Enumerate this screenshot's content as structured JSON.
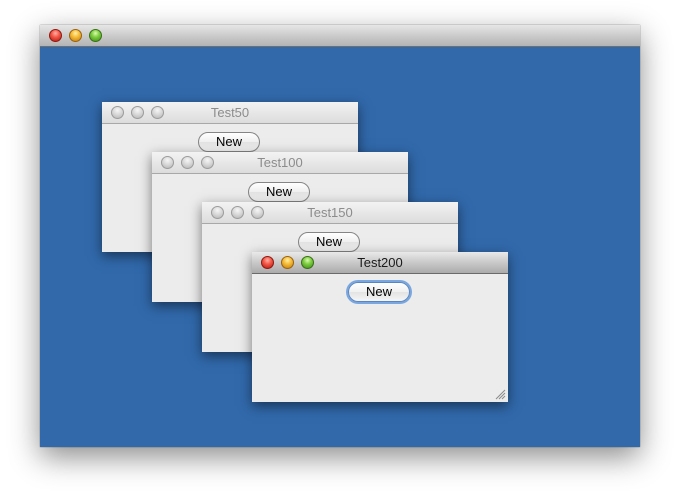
{
  "desktop": {
    "background_color": "#3169ab"
  },
  "windows": [
    {
      "title": "Test50",
      "button_label": "New",
      "active": false
    },
    {
      "title": "Test100",
      "button_label": "New",
      "active": false
    },
    {
      "title": "Test150",
      "button_label": "New",
      "active": false
    },
    {
      "title": "Test200",
      "button_label": "New",
      "active": true
    }
  ]
}
